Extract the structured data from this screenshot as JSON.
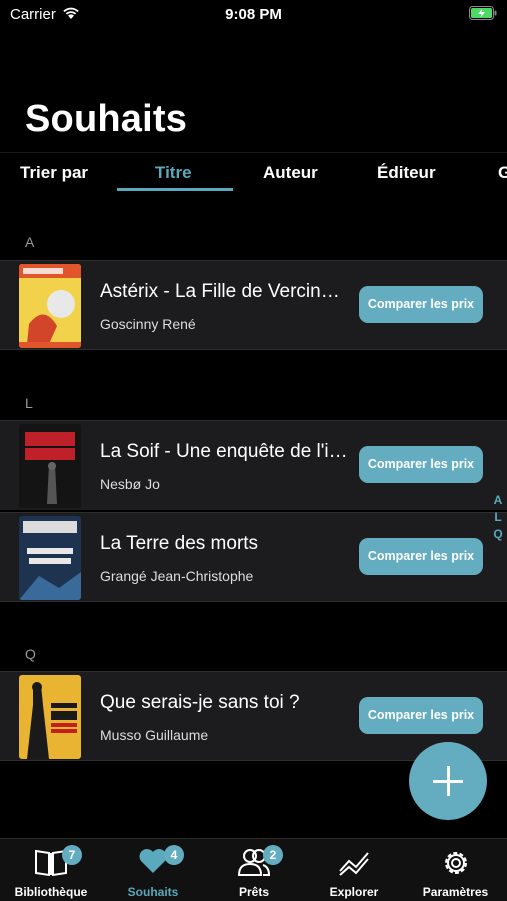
{
  "status": {
    "carrier": "Carrier",
    "time": "9:08 PM"
  },
  "page_title": "Souhaits",
  "sort": {
    "label": "Trier par",
    "options": [
      "Titre",
      "Auteur",
      "Éditeur",
      "G"
    ],
    "selected": "Titre"
  },
  "sections": [
    {
      "letter": "A",
      "books": [
        {
          "title": "Astérix - La Fille de Vercingétorix",
          "author": "Goscinny René",
          "cover_color": "#e0562a"
        }
      ]
    },
    {
      "letter": "L",
      "books": [
        {
          "title": "La Soif - Une enquête de l'inspecteur Harry Hole",
          "author": "Nesbø Jo",
          "cover_color": "#1a1a1a"
        },
        {
          "title": "La Terre des morts",
          "author": "Grangé Jean-Christophe",
          "cover_color": "#2a4a6a"
        }
      ]
    },
    {
      "letter": "Q",
      "books": [
        {
          "title": "Que serais-je sans toi ?",
          "author": "Musso Guillaume",
          "cover_color": "#e8b432"
        }
      ]
    }
  ],
  "compare_label": "Comparer les prix",
  "index_letters": [
    "A",
    "L",
    "Q"
  ],
  "tabs": [
    {
      "label": "Bibliothèque",
      "badge": "7",
      "icon": "book-icon"
    },
    {
      "label": "Souhaits",
      "badge": "4",
      "icon": "heart-icon"
    },
    {
      "label": "Prêts",
      "badge": "2",
      "icon": "people-icon"
    },
    {
      "label": "Explorer",
      "badge": "",
      "icon": "trend-icon"
    },
    {
      "label": "Paramètres",
      "badge": "",
      "icon": "gear-icon"
    }
  ],
  "colors": {
    "accent": "#64adc1",
    "background": "#000000",
    "row": "#1c1c1e"
  }
}
